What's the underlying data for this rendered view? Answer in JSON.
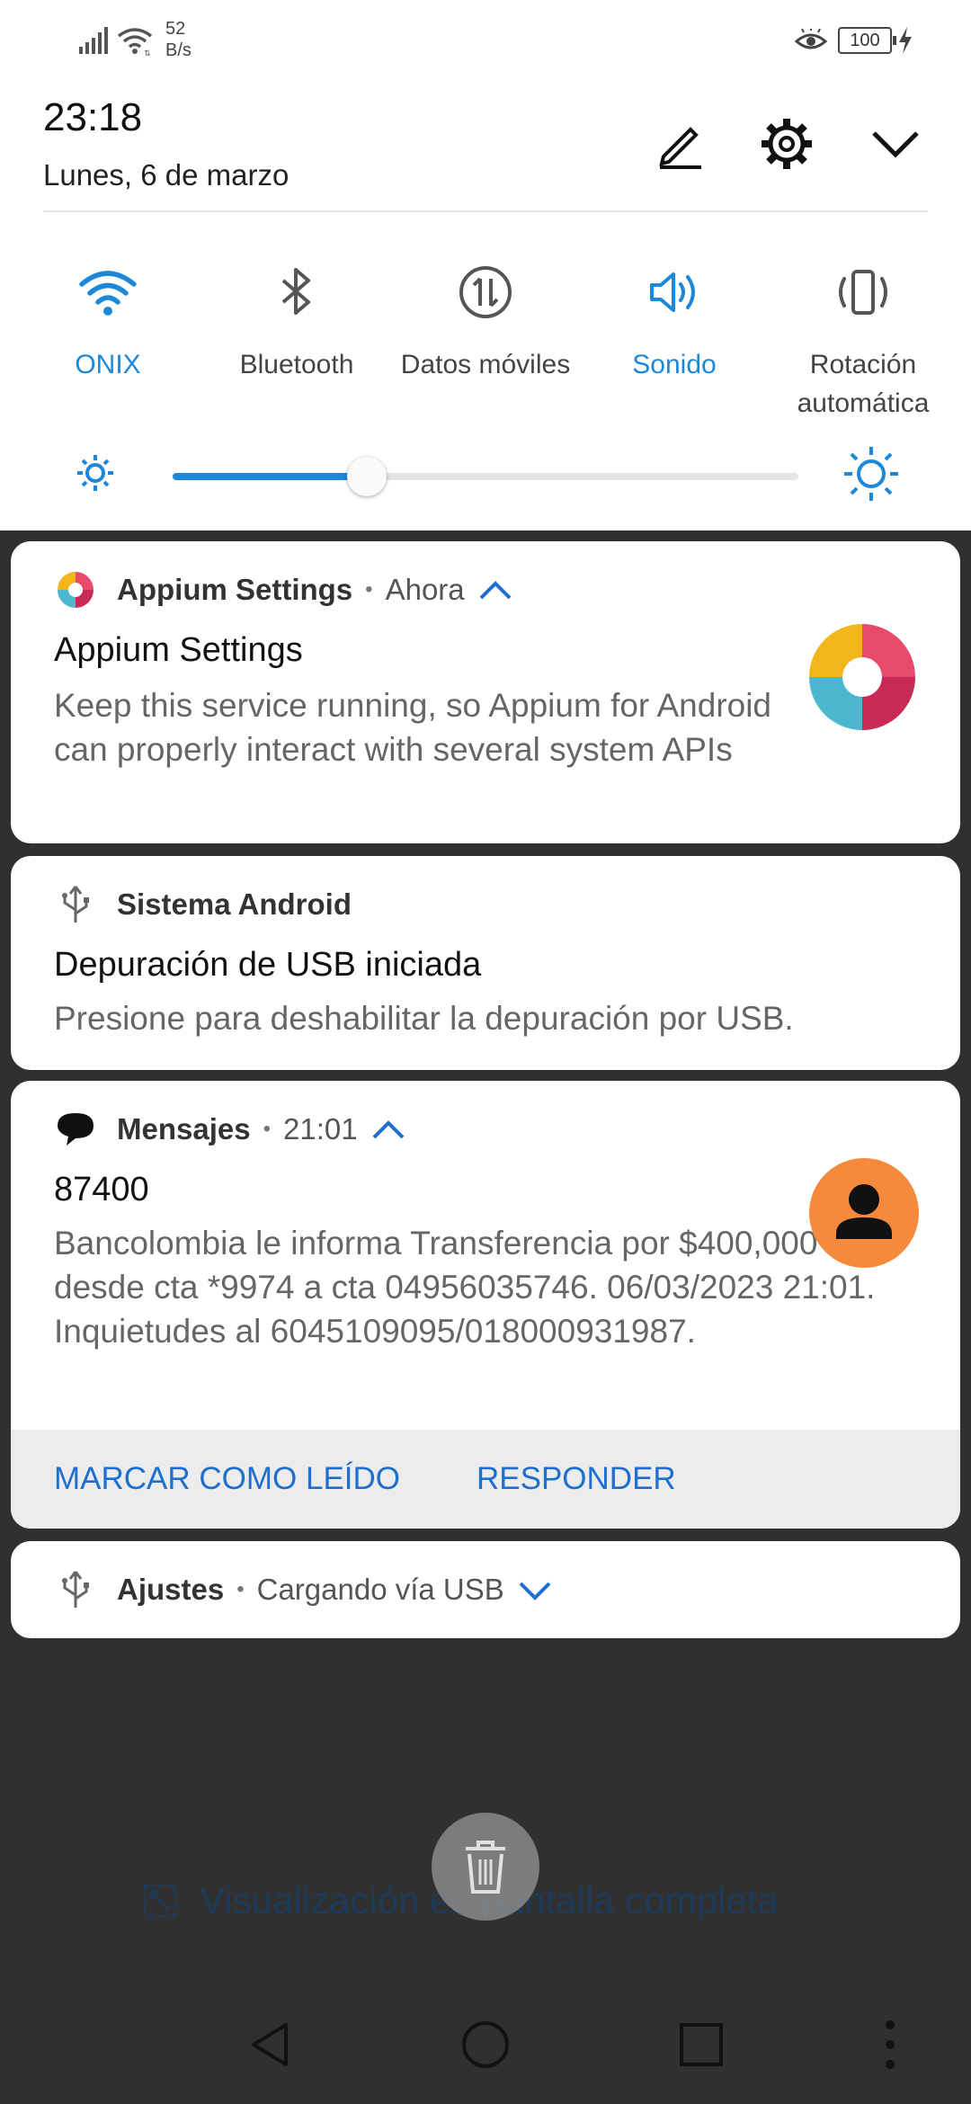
{
  "status_bar": {
    "net_speed_value": "52",
    "net_speed_unit": "B/s",
    "battery": "100"
  },
  "quick_settings": {
    "time": "23:18",
    "date": "Lunes, 6 de marzo",
    "tiles": [
      {
        "label": "ONIX",
        "icon": "wifi-icon",
        "active": true
      },
      {
        "label": "Bluetooth",
        "icon": "bluetooth-icon",
        "active": false
      },
      {
        "label": "Datos móviles",
        "icon": "mobile-data-icon",
        "active": false
      },
      {
        "label": "Sonido",
        "icon": "sound-icon",
        "active": true
      },
      {
        "label": "Rotación automática",
        "icon": "auto-rotate-icon",
        "active": false
      }
    ],
    "brightness_fraction": 0.31,
    "accent_color": "#1e88d8"
  },
  "notifications": {
    "appium": {
      "app": "Appium Settings",
      "when": "Ahora",
      "title": "Appium Settings",
      "body": "Keep this service running, so Appium for Android can properly interact with several system APIs"
    },
    "usb_debug": {
      "app": "Sistema Android",
      "title": "Depuración de USB iniciada",
      "body": "Presione para deshabilitar la depuración por USB."
    },
    "messages": {
      "app": "Mensajes",
      "when": "21:01",
      "title": "87400",
      "body": "Bancolombia le informa Transferencia por $400,000 desde cta *9974 a cta 04956035746. 06/03/2023 21:01. Inquietudes al 6045109095/018000931987.",
      "action_mark_read": "MARCAR COMO LEÍDO",
      "action_reply": "RESPONDER",
      "avatar_color": "#f58a3c"
    },
    "charging": {
      "app": "Ajustes",
      "when": "Cargando vía USB"
    }
  },
  "background": {
    "fullscreen_hint": "Visualización en pantalla completa"
  }
}
